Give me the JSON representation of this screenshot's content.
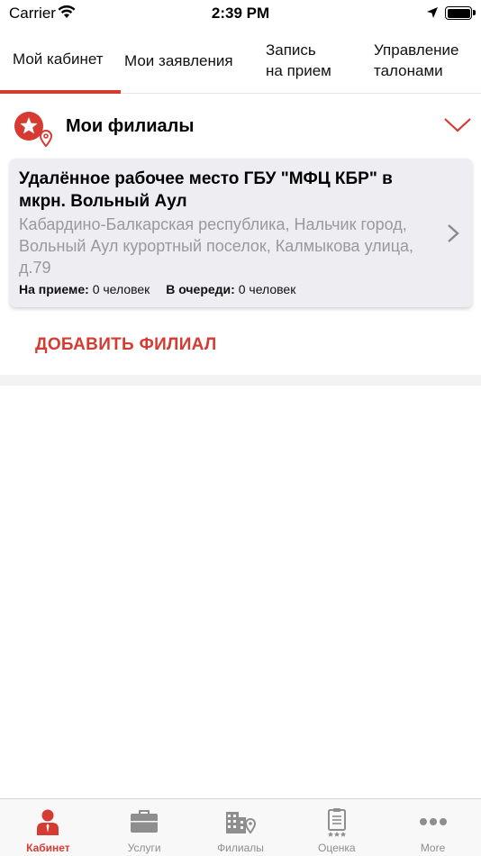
{
  "status_bar": {
    "carrier": "Carrier",
    "time": "2:39 PM"
  },
  "tabs": [
    {
      "line1": "Мой кабинет",
      "line2": ""
    },
    {
      "line1": "Мои заявления",
      "line2": ""
    },
    {
      "line1": "Запись",
      "line2": "на прием"
    },
    {
      "line1": "Управление",
      "line2": "талонами"
    }
  ],
  "section": {
    "title": "Мои филиалы"
  },
  "branch": {
    "name": "Удалённое рабочее место ГБУ \"МФЦ КБР\" в мкрн. Вольный Аул",
    "address": "Кабардино-Балкарская республика, Нальчик город, Вольный Аул курортный поселок, Калмыкова улица, д.79",
    "reception_label": "На приеме:",
    "reception_value": "0 человек",
    "queue_label": "В очереди:",
    "queue_value": "0 человек"
  },
  "add_branch_label": "ДОБАВИТЬ ФИЛИАЛ",
  "tabbar": [
    {
      "label": "Кабинет",
      "icon": "person-icon"
    },
    {
      "label": "Услуги",
      "icon": "briefcase-icon"
    },
    {
      "label": "Филиалы",
      "icon": "buildings-icon"
    },
    {
      "label": "Оценка",
      "icon": "rating-clipboard-icon"
    },
    {
      "label": "More",
      "icon": "more-icon"
    }
  ],
  "colors": {
    "accent": "#d63b33",
    "card_bg": "#ededf2",
    "inactive": "#8e8e8e"
  }
}
